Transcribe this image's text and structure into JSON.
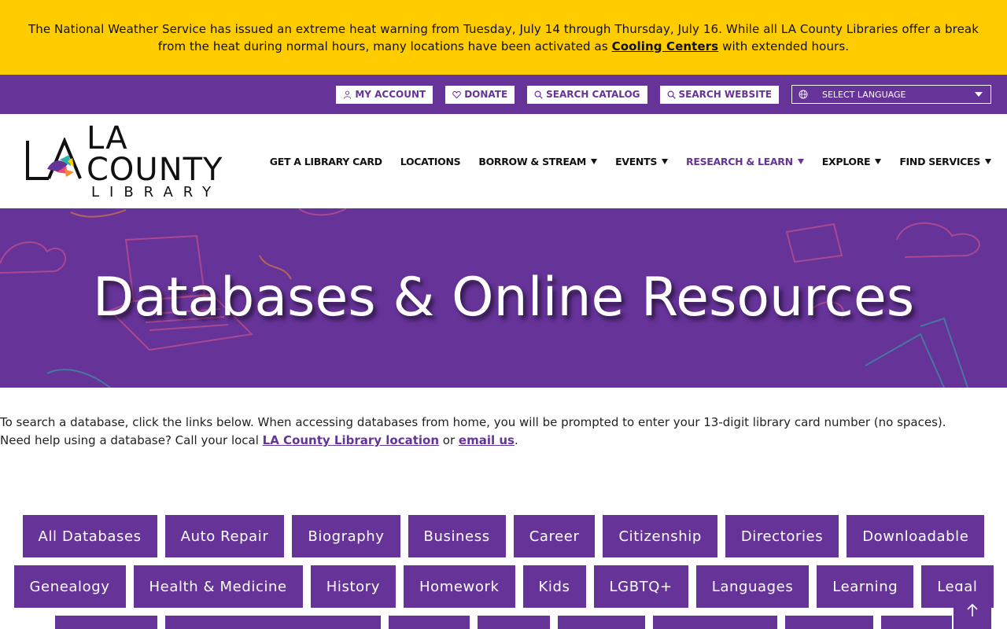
{
  "alert": {
    "text_before": "The National Weather Service has issued an extreme heat warning from Tuesday, July 14 through Thursday, July 16. While all LA County Libraries offer a break from the heat during normal hours, many locations have been activated as ",
    "link": "Cooling Centers",
    "text_after": " with extended hours."
  },
  "utility": {
    "my_account": "MY ACCOUNT",
    "donate": "DONATE",
    "search_catalog": "SEARCH CATALOG",
    "search_website": "SEARCH WEBSITE",
    "language": "SELECT LANGUAGE"
  },
  "logo": {
    "county": "LA COUNTY",
    "library": "LIBRARY"
  },
  "nav": [
    {
      "label": "GET A LIBRARY CARD"
    },
    {
      "label": "LOCATIONS"
    },
    {
      "label": "BORROW & STREAM"
    },
    {
      "label": "EVENTS"
    },
    {
      "label": "RESEARCH & LEARN"
    },
    {
      "label": "EXPLORE"
    },
    {
      "label": "FIND SERVICES"
    }
  ],
  "hero": {
    "title": "Databases & Online Resources"
  },
  "intro": {
    "line1": "To search a database, click the links below. When accessing databases from home, you will be prompted to enter your 13-digit library card number (no spaces).",
    "line2_before": "Need help using a database? Call your local ",
    "link_location": "LA County Library location",
    "line2_mid": " or ",
    "link_email": "email us",
    "line2_after": "."
  },
  "categories": {
    "row1": [
      "All Databases",
      "Auto Repair",
      "Biography",
      "Business",
      "Career",
      "Citizenship",
      "Directories",
      "Downloadable"
    ],
    "row2": [
      "Genealogy",
      "Health & Medicine",
      "History",
      "Homework",
      "Kids",
      "LGBTQ+",
      "Languages",
      "Learning",
      "Legal"
    ]
  },
  "colors": {
    "brand": "#663399",
    "alert": "#ffcc00"
  }
}
